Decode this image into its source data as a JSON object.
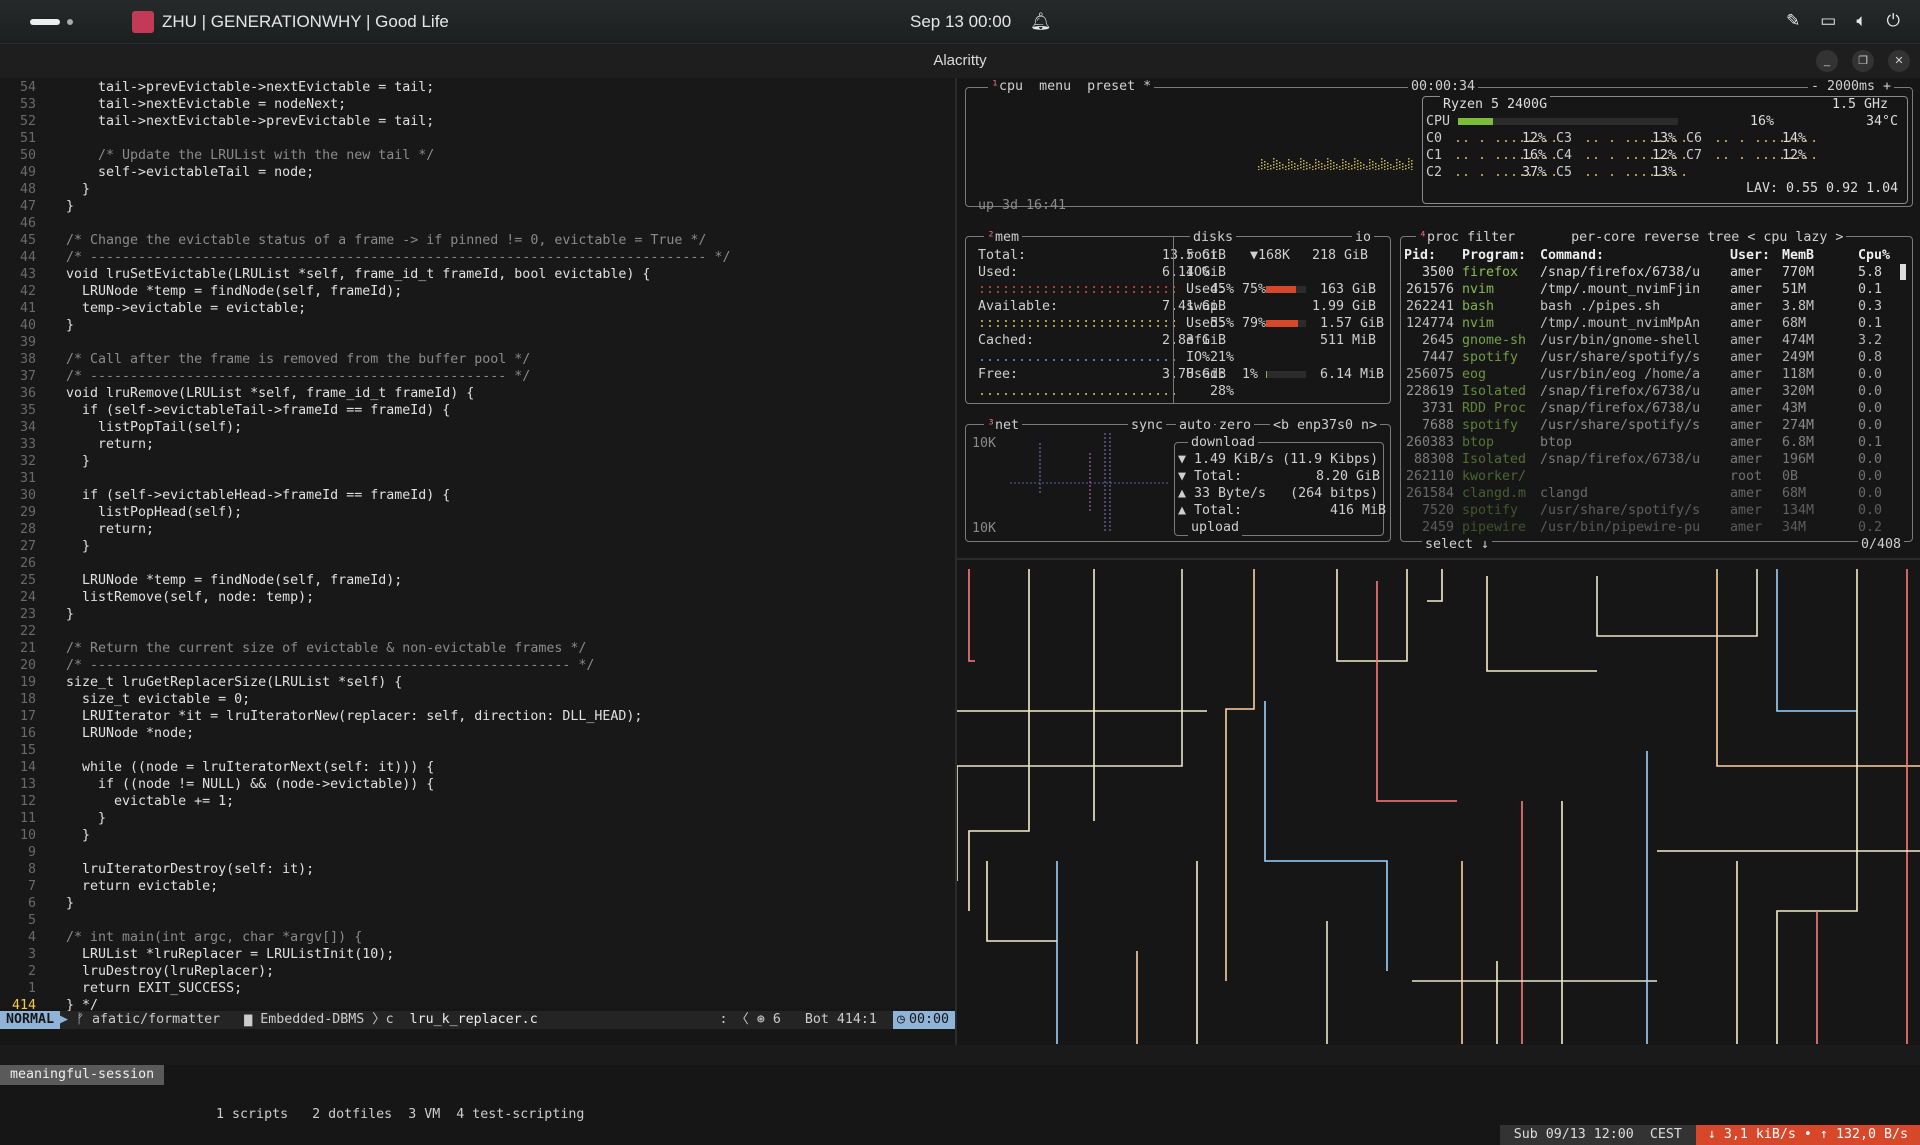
{
  "topbar": {
    "now_playing": "ZHU | GENERATIONWHY | Good Life",
    "clock": "Sep 13  00:00"
  },
  "window": {
    "title": "Alacritty"
  },
  "editor": {
    "lines": [
      {
        "n": "54",
        "t": "    tail->prevEvictable->nextEvictable = tail;"
      },
      {
        "n": "53",
        "t": "    tail->nextEvictable = nodeNext;"
      },
      {
        "n": "52",
        "t": "    tail->nextEvictable->prevEvictable = tail;"
      },
      {
        "n": "51",
        "t": ""
      },
      {
        "n": "50",
        "t": "    /* Update the LRUList with the new tail */"
      },
      {
        "n": "49",
        "t": "    self->evictableTail = node;"
      },
      {
        "n": "48",
        "t": "  }"
      },
      {
        "n": "47",
        "t": "}"
      },
      {
        "n": "46",
        "t": ""
      },
      {
        "n": "45",
        "t": "/* Change the evictable status of a frame -> if pinned != 0, evictable = True */"
      },
      {
        "n": "44",
        "t": "/* ----------------------------------------------------------------------------- */"
      },
      {
        "n": "43",
        "t": "void lruSetEvictable(LRUList *self, frame_id_t frameId, bool evictable) {"
      },
      {
        "n": "42",
        "t": "  LRUNode *temp = findNode(self, frameId);"
      },
      {
        "n": "41",
        "t": "  temp->evictable = evictable;"
      },
      {
        "n": "40",
        "t": "}"
      },
      {
        "n": "39",
        "t": ""
      },
      {
        "n": "38",
        "t": "/* Call after the frame is removed from the buffer pool */"
      },
      {
        "n": "37",
        "t": "/* ---------------------------------------------------- */"
      },
      {
        "n": "36",
        "t": "void lruRemove(LRUList *self, frame_id_t frameId) {"
      },
      {
        "n": "35",
        "t": "  if (self->evictableTail->frameId == frameId) {"
      },
      {
        "n": "34",
        "t": "    listPopTail(self);"
      },
      {
        "n": "33",
        "t": "    return;"
      },
      {
        "n": "32",
        "t": "  }"
      },
      {
        "n": "31",
        "t": ""
      },
      {
        "n": "30",
        "t": "  if (self->evictableHead->frameId == frameId) {"
      },
      {
        "n": "29",
        "t": "    listPopHead(self);"
      },
      {
        "n": "28",
        "t": "    return;"
      },
      {
        "n": "27",
        "t": "  }"
      },
      {
        "n": "26",
        "t": ""
      },
      {
        "n": "25",
        "t": "  LRUNode *temp = findNode(self, frameId);"
      },
      {
        "n": "24",
        "t": "  listRemove(self, node: temp);"
      },
      {
        "n": "23",
        "t": "}"
      },
      {
        "n": "22",
        "t": ""
      },
      {
        "n": "21",
        "t": "/* Return the current size of evictable & non-evictable frames */"
      },
      {
        "n": "20",
        "t": "/* ------------------------------------------------------------ */"
      },
      {
        "n": "19",
        "t": "size_t lruGetReplacerSize(LRUList *self) {"
      },
      {
        "n": "18",
        "t": "  size_t evictable = 0;"
      },
      {
        "n": "17",
        "t": "  LRUIterator *it = lruIteratorNew(replacer: self, direction: DLL_HEAD);"
      },
      {
        "n": "16",
        "t": "  LRUNode *node;"
      },
      {
        "n": "15",
        "t": ""
      },
      {
        "n": "14",
        "t": "  while ((node = lruIteratorNext(self: it))) {"
      },
      {
        "n": "13",
        "t": "    if ((node != NULL) && (node->evictable)) {"
      },
      {
        "n": "12",
        "t": "      evictable += 1;"
      },
      {
        "n": "11",
        "t": "    }"
      },
      {
        "n": "10",
        "t": "  }"
      },
      {
        "n": "9",
        "t": ""
      },
      {
        "n": "8",
        "t": "  lruIteratorDestroy(self: it);"
      },
      {
        "n": "7",
        "t": "  return evictable;"
      },
      {
        "n": "6",
        "t": "}"
      },
      {
        "n": "5",
        "t": ""
      },
      {
        "n": "4",
        "t": "/* int main(int argc, char *argv[]) {"
      },
      {
        "n": "3",
        "t": "  LRUList *lruReplacer = LRUListInit(10);"
      },
      {
        "n": "2",
        "t": "  lruDestroy(lruReplacer);"
      },
      {
        "n": "1",
        "t": "  return EXIT_SUCCESS;"
      },
      {
        "n": "414",
        "t": "} */"
      }
    ],
    "status": {
      "mode": "NORMAL",
      "branch": "afatic/formatter",
      "project": "Embedded-DBMS",
      "lang": "c",
      "file": "lru_k_replacer.c",
      "diag": "6",
      "position": "Bot 414:1",
      "time": "00:00"
    }
  },
  "tmux": {
    "session": "meaningful-session",
    "windows": [
      "1 scripts",
      "2 dotfiles",
      "3 VM",
      "4 test-scripting"
    ],
    "datetime": "Sub 09/13 12:00  CEST",
    "net": "↓ 3,1 kiB/s • ↑ 132,0 B/s"
  },
  "btop": {
    "cpu": {
      "tabs": [
        "cpu",
        "menu",
        "preset *"
      ],
      "timer": "00:00:34",
      "interval": "- 2000ms +",
      "model": "Ryzen 5 2400G",
      "freq": "1.5 GHz",
      "uptime": "up 3d 16:41",
      "total": {
        "label": "CPU",
        "pct": "16%",
        "temp": "34°C",
        "value": 0.16
      },
      "cores": [
        {
          "label": "C0",
          "pct": "12%"
        },
        {
          "label": "C3",
          "pct": "13%"
        },
        {
          "label": "C6",
          "pct": "14%"
        },
        {
          "label": "C1",
          "pct": "16%"
        },
        {
          "label": "C4",
          "pct": "12%"
        },
        {
          "label": "C7",
          "pct": "12%"
        },
        {
          "label": "C2",
          "pct": "37%"
        },
        {
          "label": "C5",
          "pct": "13%"
        }
      ],
      "lav": "LAV: 0.55 0.92 1.04"
    },
    "mem": {
      "title": "mem",
      "total": {
        "label": "Total:",
        "value": "13.5 GiB"
      },
      "used": {
        "label": "Used:",
        "value": "6.14 GiB",
        "pct": "45%"
      },
      "available": {
        "label": "Available:",
        "value": "7.41 GiB",
        "pct": "55%"
      },
      "cached": {
        "label": "Cached:",
        "value": "2.83 GiB",
        "pct": "21%"
      },
      "free": {
        "label": "Free:",
        "value": "3.78 GiB",
        "pct": "28%"
      }
    },
    "disks": {
      "title": "disks",
      "io_tab": "io",
      "root": {
        "name": "root",
        "io": "▼168K",
        "size": "218 GiB",
        "used_pct": "75%",
        "used": "163 GiB",
        "value": 0.75
      },
      "swap": {
        "name": "swap",
        "size": "1.99 GiB",
        "used_pct": "79%",
        "used": "1.57 GiB",
        "value": 0.79
      },
      "efi": {
        "name": "efi",
        "size": "511 MiB",
        "used_pct": "1%",
        "used": "6.14 MiB",
        "value": 0.01
      }
    },
    "net": {
      "title": "net",
      "tabs": [
        "sync",
        "auto",
        "zero",
        "<b enp37s0 n>"
      ],
      "scale_top": "10K",
      "scale_bottom": "10K",
      "download_label": "download",
      "down_rate": "▼ 1.49 KiB/s (11.9 Kibps)",
      "down_total": "▼ Total:",
      "down_total_val": "8.20 GiB",
      "up_rate": "▲ 33 Byte/s   (264 bitps)",
      "up_total": "▲ Total:",
      "up_total_val": "416 MiB",
      "upload_label": "upload"
    },
    "proc": {
      "tabs": [
        "proc",
        "filter",
        "per-core",
        "reverse",
        "tree",
        "< cpu lazy >"
      ],
      "headers": [
        "Pid:",
        "Program:",
        "Command:",
        "User:",
        "MemB",
        "Cpu%"
      ],
      "rows": [
        [
          "3500",
          "firefox",
          "/snap/firefox/6738/u",
          "amer",
          "770M",
          "5.8"
        ],
        [
          "261576",
          "nvim",
          "/tmp/.mount_nvimFjin",
          "amer",
          "51M",
          "0.1"
        ],
        [
          "262241",
          "bash",
          "bash ./pipes.sh",
          "amer",
          "3.8M",
          "0.3"
        ],
        [
          "124774",
          "nvim",
          "/tmp/.mount_nvimMpAn",
          "amer",
          "68M",
          "0.1"
        ],
        [
          "2645",
          "gnome-sh",
          "/usr/bin/gnome-shell",
          "amer",
          "474M",
          "3.2"
        ],
        [
          "7447",
          "spotify",
          "/usr/share/spotify/s",
          "amer",
          "249M",
          "0.8"
        ],
        [
          "256075",
          "eog",
          "/usr/bin/eog /home/a",
          "amer",
          "118M",
          "0.0"
        ],
        [
          "228619",
          "Isolated",
          "/snap/firefox/6738/u",
          "amer",
          "320M",
          "0.0"
        ],
        [
          "3731",
          "RDD Proc",
          "/snap/firefox/6738/u",
          "amer",
          "43M",
          "0.0"
        ],
        [
          "7688",
          "spotify",
          "/usr/share/spotify/s",
          "amer",
          "274M",
          "0.0"
        ],
        [
          "260383",
          "btop",
          "btop",
          "amer",
          "6.8M",
          "0.1"
        ],
        [
          "88308",
          "Isolated",
          "/snap/firefox/6738/u",
          "amer",
          "196M",
          "0.0"
        ],
        [
          "262110",
          "kworker/",
          "",
          "root",
          "0B",
          "0.0"
        ],
        [
          "261584",
          "clangd.m",
          "clangd",
          "amer",
          "68M",
          "0.0"
        ],
        [
          "7520",
          "spotify",
          "/usr/share/spotify/s",
          "amer",
          "134M",
          "0.0"
        ],
        [
          "2459",
          "pipewire",
          "/usr/bin/pipewire-pu",
          "amer",
          "34M",
          "0.2"
        ]
      ],
      "footer_left": "select ↓",
      "footer_right": "0/408"
    }
  },
  "colors": {
    "accent": "#d7482b",
    "vim_mode": "#8fb4d8",
    "cursor_line": "#f7c948"
  }
}
